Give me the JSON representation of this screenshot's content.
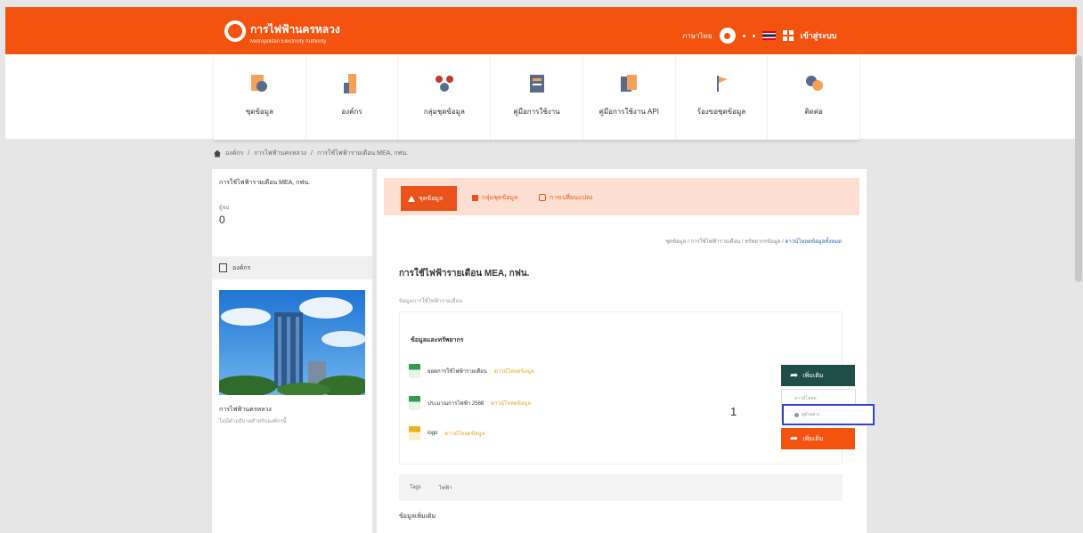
{
  "header": {
    "brand_th": "การไฟฟ้านครหลวง",
    "brand_en": "Metropolitan Electricity Authority",
    "lang_label": "ภาษาไทย",
    "login_label": "เข้าสู่ระบบ"
  },
  "nav": {
    "items": [
      {
        "label": "ชุดข้อมูล",
        "icon": "dataset-icon"
      },
      {
        "label": "องค์กร",
        "icon": "organization-icon"
      },
      {
        "label": "กลุ่มชุดข้อมูล",
        "icon": "group-icon"
      },
      {
        "label": "คู่มือการใช้งาน",
        "icon": "manual-icon"
      },
      {
        "label": "คู่มือการใช้งาน API",
        "icon": "api-icon"
      },
      {
        "label": "ร้องขอชุดข้อมูล",
        "icon": "request-icon"
      },
      {
        "label": "ติดต่อ",
        "icon": "contact-icon"
      }
    ]
  },
  "breadcrumb": [
    "องค์กร",
    "การไฟฟ้านครหลวง",
    "การใช้ไฟฟ้ารายเดือน MEA, กฟน."
  ],
  "sidebar": {
    "dataset_title": "การใช้ไฟฟ้ารายเดือน MEA, กฟน.",
    "views_label": "ผู้ชม",
    "views_value": "0",
    "org_section": "องค์กร",
    "org_name": "การไฟฟ้านครหลวง",
    "org_desc": "ไม่มีคำอธิบายสำหรับองค์กรนี้"
  },
  "tabs": [
    {
      "label": "ชุดข้อมูล"
    },
    {
      "label": "กลุ่มชุดข้อมูล"
    },
    {
      "label": "การเปลี่ยนแปลง"
    }
  ],
  "main": {
    "sub_crumbs": "ชุดข้อมูล / การใช้ไฟฟ้ารายเดือน / ทรัพยากรข้อมูล / ",
    "sub_crumbs_active": "ดาวน์โหลดข้อมูลทั้งหมด",
    "title": "การใช้ไฟฟ้ารายเดือน MEA, กฟน.",
    "subtitle": "ข้อมูลการใช้ไฟฟ้ารายเดือน",
    "resources_head": "ข้อมูลและทรัพยากร",
    "resources": [
      {
        "name": "ยอดการใช้ไฟฟ้ารายเดือน",
        "tag": "ดาวน์โหลดข้อมูล",
        "color": "green"
      },
      {
        "name": "ประมาณการไฟฟ้า 2568",
        "tag": "ดาวน์โหลดข้อมูล",
        "color": "green"
      },
      {
        "name": "logo",
        "tag": "ดาวน์โหลดข้อมูล",
        "color": "yellow"
      }
    ],
    "download_label": "เพิ่มเติม",
    "dropdown_item1": "ดาวน์โหลด",
    "dropdown_item2": "ดูตัวอย่าง",
    "step_number": "1",
    "tags": [
      "Tags",
      "ไฟฟ้า"
    ],
    "info_head": "ข้อมูลเพิ่มเติม"
  }
}
